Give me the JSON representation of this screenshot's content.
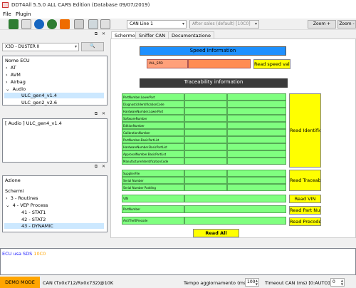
{
  "window": {
    "title": "DDT4All 5.5.0 ALL CARS Edition (Database 09/07/2019)"
  },
  "menu": {
    "file": "File",
    "plugin": "Plugin"
  },
  "toolbar": {
    "can_line": "CAN Line 1",
    "session": "After sales (default) [10C0]",
    "zoom_in": "Zoom +",
    "zoom_out": "Zoom -"
  },
  "left": {
    "vehicle": "X3D - DUSTER II",
    "ecu_header": "Nome ECU",
    "ecu_tree": [
      "AT",
      "AVM",
      "Airbag",
      "Audio",
      "ULC_gen4_v1.4",
      "ULC_gen2_v2.6"
    ],
    "current_ecu": "[ Audio ] ULC_gen4_v1.4",
    "azione_label": "Azione",
    "screens_header": "Schermi",
    "screens": [
      "3 - Routines",
      "4 - VEP Process",
      "41 - STAT1",
      "42 - STAT2",
      "43 - DYNAMIC"
    ]
  },
  "tabs": [
    "Schermo",
    "Sniffer CAN",
    "Documentazione"
  ],
  "screen": {
    "speed_title": "Speed Information",
    "speed_field": "VAL_SPD",
    "read_speed": "Read speed value",
    "trace_title": "Traceability information",
    "trace_fields": [
      "PartNumber.LowerPart",
      "DiagnosticIdentificationCode",
      "HardwareNumber.LowerPart",
      "SoftwareNumber",
      "EditionNumber",
      "CalibrationNumber",
      "PartNumber.BasicPartList",
      "HardwareNumber.BasicPartList",
      "ApprovalNumber.BasicPartList",
      "ManufacturerIdentificationCode"
    ],
    "read_ident": "Read Identification",
    "supplier_fields": [
      "SupplierFile",
      "Serial Number",
      "Serial Number Padding"
    ],
    "read_trace": "Read Traceability",
    "vin_field": "VIN",
    "read_vin": "Read VIN",
    "partnum_field": "PartNumber",
    "read_partnum": "Read Part Number",
    "antitheft_field": "AntiTheftPrecode",
    "read_precode": "Read Precode",
    "read_all": "Read All"
  },
  "log": {
    "prefix": "ECU usa SDS",
    "code": "10C0"
  },
  "status": {
    "demo": "DEMO MODE",
    "can": "CAN (Tx0x712/Rx0x732)@10K",
    "refresh_label": "Tempo aggiornamento (ms)",
    "refresh_value": "100",
    "timeout_label": "Timeout CAN (ms) [0:AUTO] :",
    "timeout_value": "0"
  },
  "colors": {
    "speed_bar": "#1e90ff",
    "trace_bar": "#3a3a3a",
    "field_green": "#80ff80",
    "button_yellow": "#ffff00",
    "demo_orange": "#ffa500",
    "log_blue": "#1a1aff",
    "log_orange": "#ffa500"
  }
}
